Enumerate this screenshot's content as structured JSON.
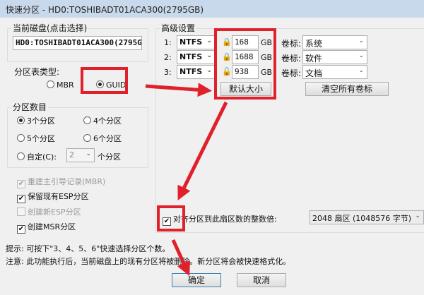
{
  "title": "快速分区 - HD0:TOSHIBADT01ACA300(2795GB)",
  "disk": {
    "label": "当前磁盘(点击选择)",
    "value": "HD0:TOSHIBADT01ACA300(2795G"
  },
  "table_type": {
    "label": "分区表类型:",
    "mbr": "MBR",
    "guid": "GUID",
    "selected": "GUID"
  },
  "count": {
    "label": "分区数目",
    "opt3": "3个分区",
    "opt4": "4个分区",
    "opt5": "5个分区",
    "opt6": "6个分区",
    "custom": "自定(C):",
    "custom_value": "2",
    "custom_suffix": "个分区",
    "selected": "3个分区"
  },
  "options": [
    {
      "label": "重建主引导记录(MBR)",
      "checked": true,
      "disabled": true
    },
    {
      "label": "保留现有ESP分区",
      "checked": true,
      "disabled": false
    },
    {
      "label": "创建新ESP分区",
      "checked": false,
      "disabled": true
    },
    {
      "label": "创建MSR分区",
      "checked": true,
      "disabled": false
    }
  ],
  "advanced": {
    "label": "高级设置",
    "unit": "GB",
    "vol_label": "卷标:",
    "rows": [
      {
        "num": "1:",
        "fs": "NTFS",
        "size": "168",
        "volume": "系统",
        "locked": true
      },
      {
        "num": "2:",
        "fs": "NTFS",
        "size": "1688",
        "volume": "软件",
        "locked": true
      },
      {
        "num": "3:",
        "fs": "NTFS",
        "size": "938",
        "volume": "文档",
        "locked": false
      }
    ],
    "default_size": "默认大小",
    "clear_labels": "清空所有卷标",
    "align_label": "对齐分区到此扇区数的整数倍:",
    "align_value": "2048 扇区 (1048576 字节)"
  },
  "hint": "提示: 可按下\"3、4、5、6\"快速选择分区个数。",
  "warning": "注意: 此功能执行后，当前磁盘上的现有分区将被删除。新分区将会被快速格式化。",
  "ok": "确定",
  "cancel": "取消",
  "accent": "#e0202a"
}
